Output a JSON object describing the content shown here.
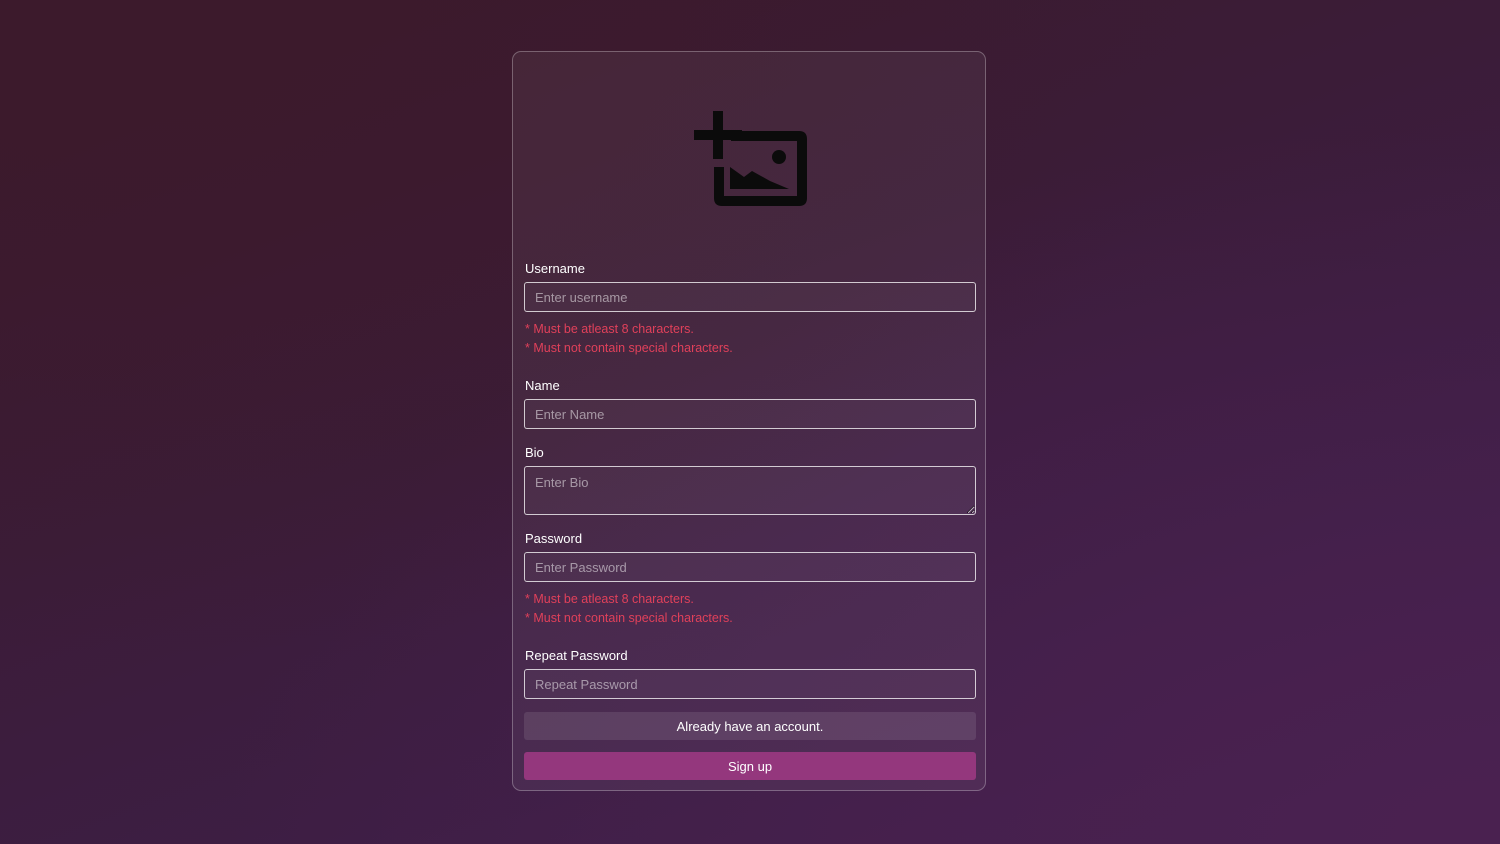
{
  "form": {
    "avatar_icon": "add-photo-icon",
    "username": {
      "label": "Username",
      "placeholder": "Enter username",
      "hints": [
        "* Must be atleast 8 characters.",
        "* Must not contain special characters."
      ]
    },
    "name": {
      "label": "Name",
      "placeholder": "Enter Name"
    },
    "bio": {
      "label": "Bio",
      "placeholder": "Enter Bio"
    },
    "password": {
      "label": "Password",
      "placeholder": "Enter Password",
      "hints": [
        "* Must be atleast 8 characters.",
        "* Must not contain special characters."
      ]
    },
    "repeat_password": {
      "label": "Repeat Password",
      "placeholder": "Repeat Password"
    },
    "login_link_label": "Already have an account.",
    "submit_label": "Sign up"
  },
  "colors": {
    "accent": "#94377d",
    "error": "#e0405a"
  }
}
